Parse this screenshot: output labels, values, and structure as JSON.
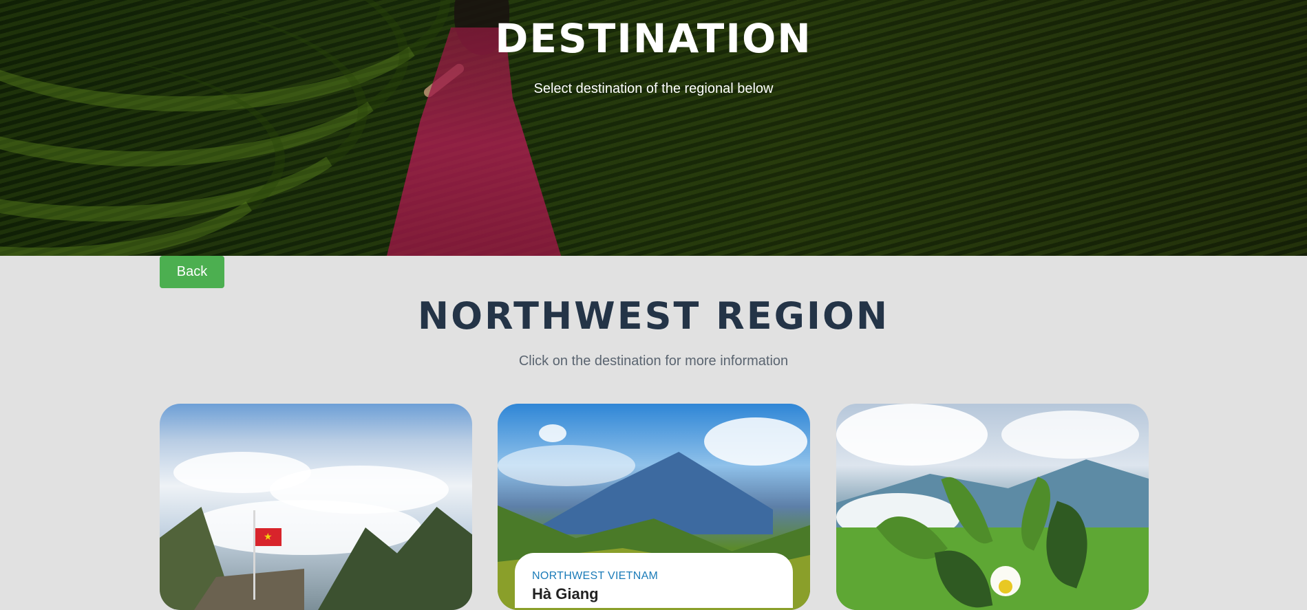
{
  "hero": {
    "title": "DESTINATION",
    "subtitle": "Select destination of the regional below"
  },
  "back_button": {
    "label": "Back"
  },
  "region": {
    "title": "NORTHWEST REGION",
    "subtitle": "Click on the destination for more information"
  },
  "cards": [
    {
      "image": "mountain-summit-sea-of-clouds-with-red-flag"
    },
    {
      "image": "green-valley-terraced-fields-and-mountains",
      "region_label": "NORTHWEST VIETNAM",
      "name_partial": "Hà Giang"
    },
    {
      "image": "tea-plant-with-white-flower-and-hills"
    }
  ],
  "colors": {
    "accent_green": "#4caf50",
    "title_navy": "#243447",
    "region_label_blue": "#1a7bb8",
    "page_background": "#e1e1e1"
  }
}
